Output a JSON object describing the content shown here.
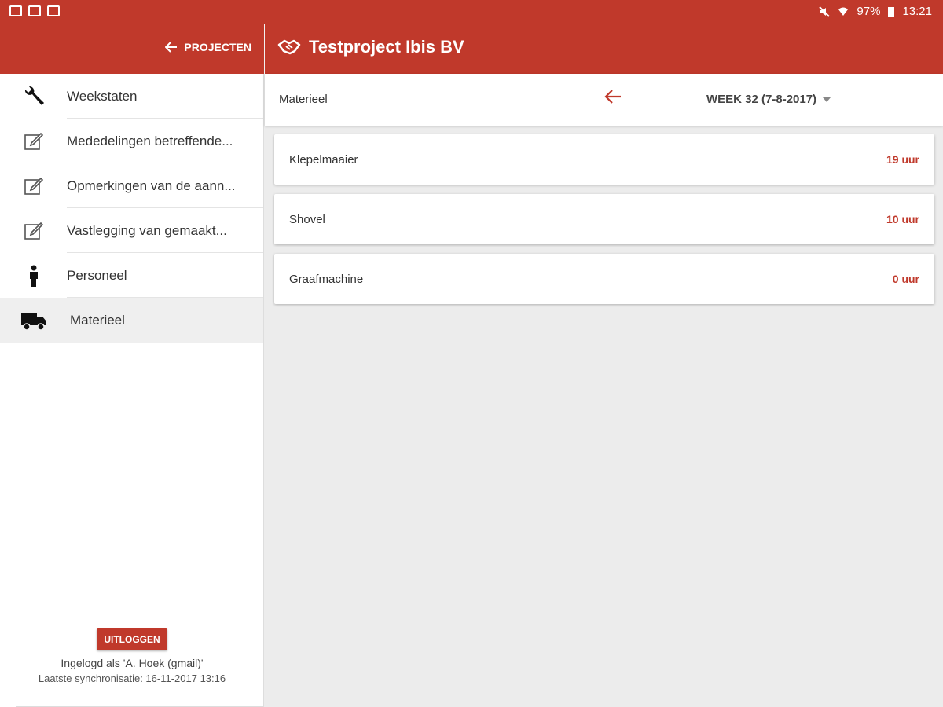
{
  "status_bar": {
    "battery": "97%",
    "time": "13:21",
    "left_icons": [
      "image-icon",
      "mail-icon",
      "flipboard-icon"
    ],
    "right_icons": [
      "mute-icon",
      "wifi-icon",
      "battery-icon"
    ]
  },
  "header": {
    "back_label": "PROJECTEN",
    "project_title": "Testproject Ibis BV"
  },
  "sidebar": {
    "items": [
      {
        "label": "Weekstaten",
        "icon": "wrench-icon",
        "active": false
      },
      {
        "label": "Mededelingen betreffende...",
        "icon": "edit-icon",
        "active": false
      },
      {
        "label": "Opmerkingen van de aann...",
        "icon": "edit-icon",
        "active": false
      },
      {
        "label": "Vastlegging van gemaakt...",
        "icon": "edit-icon",
        "active": false
      },
      {
        "label": "Personeel",
        "icon": "person-icon",
        "active": false
      },
      {
        "label": "Materieel",
        "icon": "truck-icon",
        "active": true
      }
    ],
    "logout_label": "UITLOGGEN",
    "logged_in_text": "Ingelogd als 'A. Hoek (gmail)'",
    "sync_text": "Laatste synchronisatie: 16-11-2017 13:16"
  },
  "toolbar": {
    "section_title": "Materieel",
    "week_label": "WEEK 32 (7-8-2017)"
  },
  "equipment": [
    {
      "name": "Klepelmaaier",
      "hours": "19 uur"
    },
    {
      "name": "Shovel",
      "hours": "10 uur"
    },
    {
      "name": "Graafmachine",
      "hours": "0 uur"
    }
  ],
  "colors": {
    "brand": "#c0392b",
    "background": "#ececec"
  }
}
